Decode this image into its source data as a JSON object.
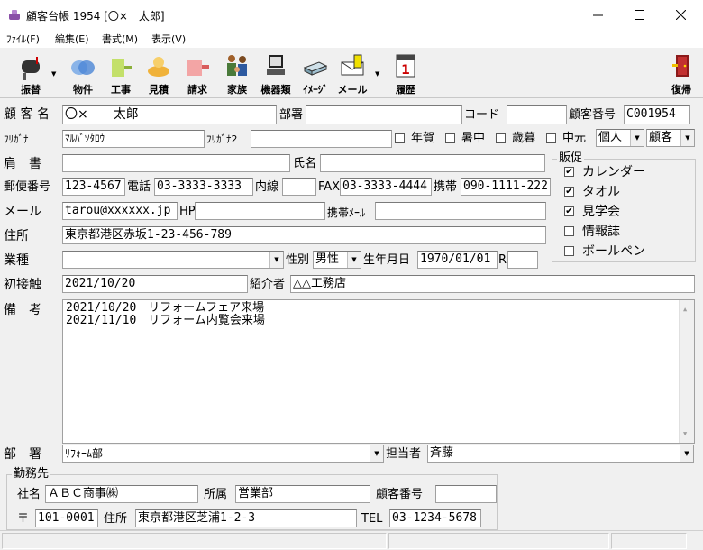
{
  "window": {
    "title": "顧客台帳 1954 [〇×　太郎]",
    "minimize": "—",
    "maximize": "☐",
    "close": "✕"
  },
  "menu": [
    "ﾌｧｲﾙ(F)",
    "編集(E)",
    "書式(M)",
    "表示(V)"
  ],
  "toolbar": {
    "transfer": "振替",
    "property": "物件",
    "construction": "工事",
    "estimate": "見積",
    "invoice": "請求",
    "family": "家族",
    "equipment": "機器類",
    "image": "ｲﾒｰｼﾞ",
    "mail": "メール",
    "history": "履歴",
    "restore": "復帰"
  },
  "labels": {
    "customer_name": "顧 客 名",
    "department": "部署",
    "code": "コード",
    "customer_number": "顧客番号",
    "furigana": "ﾌﾘｶﾞﾅ",
    "furigana2": "ﾌﾘｶﾞﾅ2",
    "new_year": "年賀",
    "summer": "暑中",
    "year_end": "歳暮",
    "mid_year": "中元",
    "job_title": "肩　書",
    "person_name": "氏名",
    "postal": "郵便番号",
    "phone": "電話",
    "extension": "内線",
    "fax": "FAX",
    "mobile": "携帯",
    "mail": "メール",
    "hp": "HP",
    "mobile_mail": "携帯ﾒｰﾙ",
    "address": "住所",
    "industry": "業種",
    "gender": "性別",
    "birthday": "生年月日",
    "first_contact": "初接触",
    "introducer": "紹介者",
    "remarks": "備　考",
    "dept": "部　署",
    "staff": "担当者",
    "workplace": "勤務先",
    "company": "社名",
    "affiliation": "所属",
    "wp_customer_number": "顧客番号",
    "postal_mark": "〒",
    "wp_address": "住所",
    "tel": "TEL",
    "promo": "販促"
  },
  "values": {
    "customer_name": "〇×　　太郎",
    "department": "",
    "code": "",
    "customer_number": "C001954",
    "furigana": "ﾏﾙﾊﾞﾂﾀﾛｳ",
    "furigana2": "",
    "type1": "個人",
    "type2": "顧客",
    "job_title": "",
    "person_name": "",
    "postal": "123-4567",
    "phone": "03-3333-3333",
    "extension": "",
    "fax": "03-3333-4444",
    "mobile": "090-1111-222",
    "mail": "tarou@xxxxxx.jp",
    "hp": "",
    "mobile_mail": "",
    "address": "東京都港区赤坂1-23-456-789",
    "industry": "",
    "gender": "男性",
    "birthday": "1970/01/01",
    "birthday_suffix": "R",
    "era": "",
    "first_contact": "2021/10/20",
    "introducer": "△△工務店",
    "remarks_line1": "2021/10/20　リフォームフェア来場",
    "remarks_line2": "2021/11/10　リフォーム内覧会来場",
    "dept": "ﾘﾌｫｰﾑ部",
    "staff": "斉藤",
    "company": "ＡＢＣ商事㈱",
    "affiliation": "営業部",
    "wp_customer_number": "",
    "wp_postal": "101-0001",
    "wp_address": "東京都港区芝浦1-2-3",
    "tel": "03-1234-5678"
  },
  "promo_items": [
    {
      "label": "カレンダー",
      "checked": "✔"
    },
    {
      "label": "タオル",
      "checked": "✔"
    },
    {
      "label": "見学会",
      "checked": "✔"
    },
    {
      "label": "情報誌",
      "checked": ""
    },
    {
      "label": "ボールペン",
      "checked": ""
    }
  ],
  "colors": {
    "accent": "#0078d7",
    "field_bg": "#ffffff",
    "window_bg": "#f0f0f0"
  }
}
